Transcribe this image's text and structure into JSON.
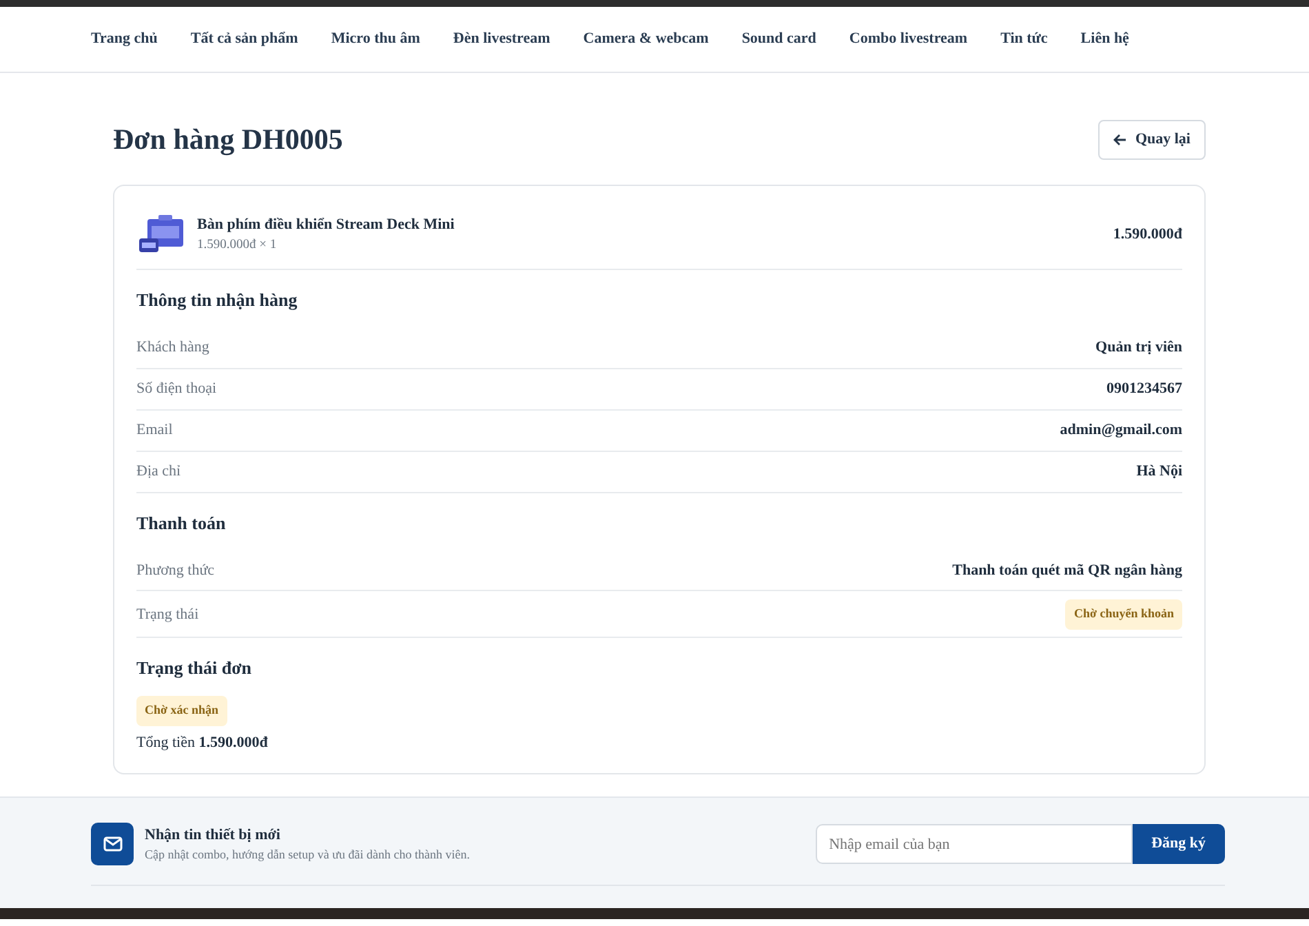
{
  "nav": {
    "items": [
      {
        "label": "Trang chủ"
      },
      {
        "label": "Tất cả sản phẩm"
      },
      {
        "label": "Micro thu âm"
      },
      {
        "label": "Đèn livestream"
      },
      {
        "label": "Camera & webcam"
      },
      {
        "label": "Sound card"
      },
      {
        "label": "Combo livestream"
      },
      {
        "label": "Tin tức"
      },
      {
        "label": "Liên hệ"
      }
    ]
  },
  "page": {
    "title": "Đơn hàng DH0005",
    "back_button": "Quay lại"
  },
  "order_item": {
    "name": "Bàn phím điều khiển Stream Deck Mini",
    "price_qty": "1.590.000đ × 1",
    "total": "1.590.000đ"
  },
  "sections": [
    {
      "title": "Thông tin nhận hàng",
      "rows": [
        {
          "label": "Khách hàng",
          "value": "Quản trị viên",
          "kind": "text"
        },
        {
          "label": "Số điện thoại",
          "value": "0901234567",
          "kind": "text"
        },
        {
          "label": "Email",
          "value": "admin@gmail.com",
          "kind": "text"
        },
        {
          "label": "Địa chỉ",
          "value": "Hà Nội",
          "kind": "text"
        }
      ]
    },
    {
      "title": "Thanh toán",
      "rows": [
        {
          "label": "Phương thức",
          "value": "Thanh toán quét mã QR ngân hàng",
          "kind": "text"
        },
        {
          "label": "Trạng thái",
          "value": "Chờ chuyển khoản",
          "kind": "badge"
        }
      ]
    }
  ],
  "order_status": {
    "title": "Trạng thái đơn",
    "badge": "Chờ xác nhận",
    "total_label": "Tổng tiền",
    "total_value": "1.590.000đ"
  },
  "newsletter": {
    "title": "Nhận tin thiết bị mới",
    "description": "Cập nhật combo, hướng dẫn setup và ưu đãi dành cho thành viên.",
    "placeholder": "Nhập email của bạn",
    "button": "Đăng ký"
  }
}
